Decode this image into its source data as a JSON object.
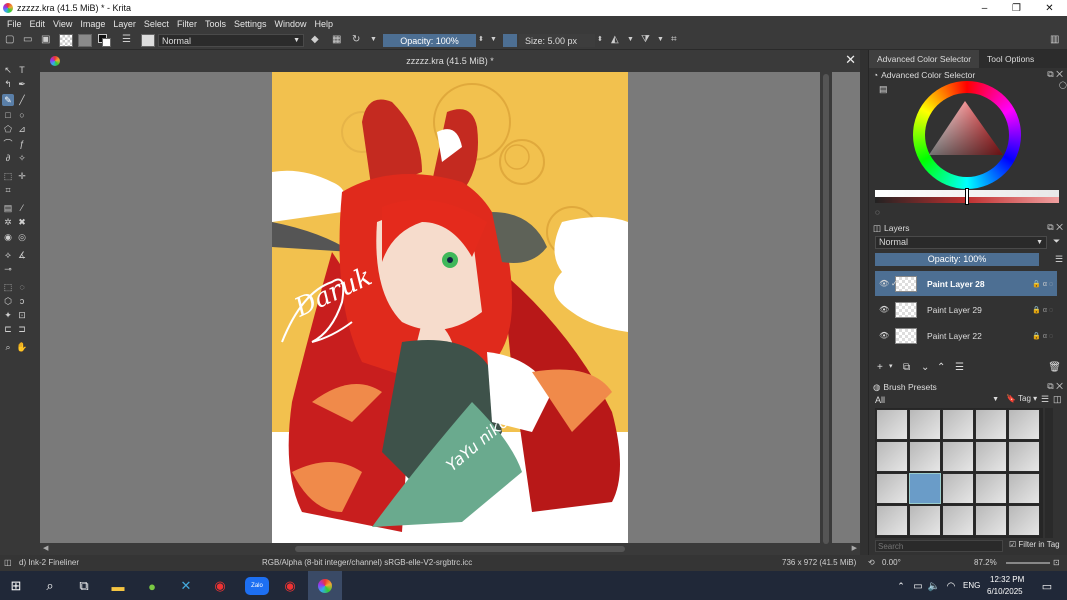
{
  "window": {
    "title": "zzzzz.kra (41.5 MiB) * - Krita",
    "minimize": "–",
    "maximize": "❐",
    "close": "✕"
  },
  "menubar": {
    "items": [
      "File",
      "Edit",
      "View",
      "Image",
      "Layer",
      "Select",
      "Filter",
      "Tools",
      "Settings",
      "Window",
      "Help"
    ]
  },
  "toolbar": {
    "blend_mode": "Normal",
    "opacity_label": "Opacity: 100%",
    "size_label": "Size: 5.00 px"
  },
  "canvas": {
    "tab_title": "zzzzz.kra (41.5 MiB) *",
    "close_label": "✕",
    "signature": "Daruk",
    "artwork_text": "YaYu niko"
  },
  "right_panel": {
    "tabs": [
      "Advanced Color Selector",
      "Tool Options"
    ],
    "color_selector_title": "Advanced Color Selector",
    "layers": {
      "title": "Layers",
      "blend_mode": "Normal",
      "opacity": "Opacity:  100%",
      "items": [
        {
          "name": "Paint Layer 28",
          "selected": true
        },
        {
          "name": "Paint Layer 29",
          "selected": false
        },
        {
          "name": "Paint Layer 22",
          "selected": false
        }
      ]
    },
    "brush_presets": {
      "title": "Brush Presets",
      "filter": "All",
      "tag_label": "Tag",
      "search_placeholder": "Search",
      "filter_in_tag": "Filter in Tag"
    }
  },
  "statusbar": {
    "brush": "d) Ink-2 Fineliner",
    "color_profile": "RGB/Alpha (8-bit integer/channel)  sRGB-elle-V2-srgbtrc.icc",
    "dimensions": "736 x 972 (41.5 MiB)",
    "rotation": "0.00°",
    "zoom": "87.2%"
  },
  "taskbar": {
    "language": "ENG",
    "time": "12:32 PM",
    "date": "6/10/2025",
    "zalo_label": "Zalo"
  },
  "colors": {
    "accent": "#5a7fa8",
    "panel": "#323232",
    "canvas_bg": "#7a7a7a",
    "artwork_yellow": "#f2c14e",
    "hair_red": "#d9241a"
  }
}
